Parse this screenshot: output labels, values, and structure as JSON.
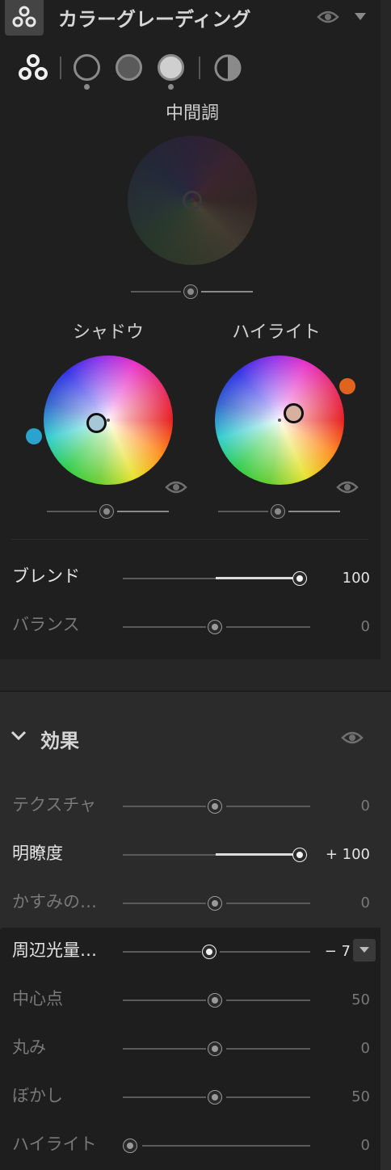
{
  "color_grading": {
    "title": "カラーグレーディング",
    "wheels": {
      "midtones": {
        "label": "中間調"
      },
      "shadows": {
        "label": "シャドウ"
      },
      "highlights": {
        "label": "ハイライト"
      }
    },
    "blend": {
      "label": "ブレンド",
      "value": "100",
      "fraction": 1.0
    },
    "balance": {
      "label": "バランス",
      "value": "0",
      "fraction": 0.5
    }
  },
  "effects": {
    "title": "効果",
    "rows": [
      {
        "label": "テクスチャ",
        "value": "0"
      },
      {
        "label": "明瞭度",
        "value": "+ 100"
      },
      {
        "label": "かすみの…",
        "value": "0"
      },
      {
        "label": "周辺光量…",
        "value": "− 7"
      },
      {
        "label": "中心点",
        "value": "50"
      },
      {
        "label": "丸み",
        "value": "0"
      },
      {
        "label": "ぼかし",
        "value": "50"
      },
      {
        "label": "ハイライト",
        "value": "0"
      }
    ]
  },
  "colors": {
    "accent_orange": "#e0641e",
    "accent_blue": "#2aa3cf"
  },
  "icons": [
    "three-circles-icon",
    "eye-icon",
    "caret-down-icon",
    "chevron-down-icon",
    "half-circle-icon"
  ]
}
